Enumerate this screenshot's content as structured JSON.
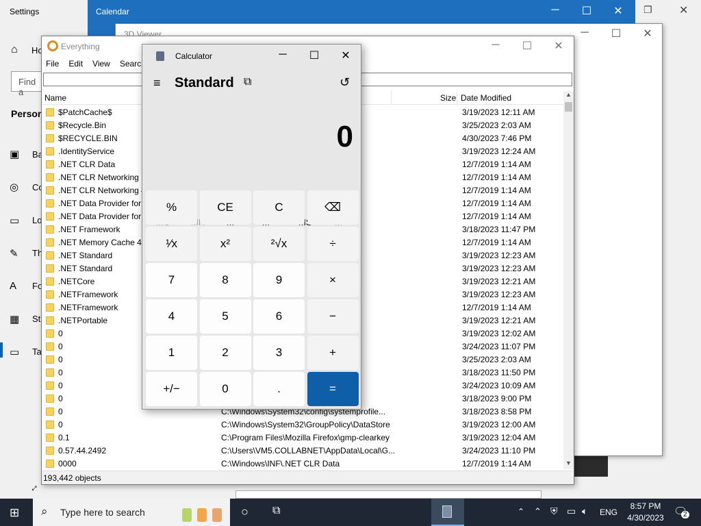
{
  "settings": {
    "title": "Settings",
    "home": "Ho",
    "find_placeholder": "Find a",
    "section": "Person",
    "items": [
      "Ba",
      "Co",
      "Lo",
      "Th",
      "Fo",
      "St",
      "Ta"
    ]
  },
  "calendar": {
    "title": "Calendar"
  },
  "viewer": {
    "title": "3D Viewer"
  },
  "everything": {
    "title": "Everything",
    "menu": [
      "File",
      "Edit",
      "View",
      "Search"
    ],
    "columns": {
      "name": "Name",
      "size": "Size",
      "date": "Date Modified"
    },
    "rows": [
      {
        "name": "$PatchCache$",
        "path": "",
        "date": "3/19/2023 12:11 AM"
      },
      {
        "name": "$Recycle.Bin",
        "path": "",
        "date": "3/25/2023 2:03 AM"
      },
      {
        "name": "$RECYCLE.BIN",
        "path": "",
        "date": "4/30/2023 7:46 PM"
      },
      {
        "name": ".IdentityService",
        "path": "",
        "date": "3/19/2023 12:24 AM"
      },
      {
        "name": ".NET CLR Data",
        "path": "",
        "date": "12/7/2019 1:14 AM"
      },
      {
        "name": ".NET CLR Networking",
        "path": "",
        "date": "12/7/2019 1:14 AM"
      },
      {
        "name": ".NET CLR Networking 4.",
        "path": "",
        "date": "12/7/2019 1:14 AM"
      },
      {
        "name": ".NET Data Provider for O",
        "path": "",
        "date": "12/7/2019 1:14 AM"
      },
      {
        "name": ".NET Data Provider for S",
        "path": "",
        "date": "12/7/2019 1:14 AM"
      },
      {
        "name": ".NET Framework",
        "path": "\\Win...",
        "date": "3/18/2023 11:47 PM"
      },
      {
        "name": ".NET Memory Cache 4.0",
        "path": "",
        "date": "12/7/2019 1:14 AM"
      },
      {
        "name": ".NET Standard",
        "path": "Studi...",
        "date": "3/19/2023 12:23 AM"
      },
      {
        "name": ".NET Standard",
        "path": "Studi...",
        "date": "3/19/2023 12:23 AM"
      },
      {
        "name": ".NETCore",
        "path": "mblies...",
        "date": "3/19/2023 12:21 AM"
      },
      {
        "name": ".NETFramework",
        "path": "mblies...",
        "date": "3/19/2023 12:23 AM"
      },
      {
        "name": ".NETFramework",
        "path": "",
        "date": "12/7/2019 1:14 AM"
      },
      {
        "name": ".NETPortable",
        "path": "mblies...",
        "date": "3/19/2023 12:21 AM"
      },
      {
        "name": "0",
        "path": "y\\Use...",
        "date": "3/19/2023 12:02 AM"
      },
      {
        "name": "0",
        "path": "y\\Use...",
        "date": "3/24/2023 11:07 PM"
      },
      {
        "name": "0",
        "path": "\\Micr...",
        "date": "3/25/2023 2:03 AM"
      },
      {
        "name": "0",
        "path": "ft\\Win...",
        "date": "3/18/2023 11:50 PM"
      },
      {
        "name": "0",
        "path": "ocal\\...",
        "date": "3/24/2023 10:09 AM"
      },
      {
        "name": "0",
        "path": "ft\\Win...",
        "date": "3/18/2023 9:00 PM"
      },
      {
        "name": "0",
        "path": "C:\\Windows\\System32\\config\\systemprofile...",
        "date": "3/18/2023 8:58 PM"
      },
      {
        "name": "0",
        "path": "C:\\Windows\\System32\\GroupPolicy\\DataStore",
        "date": "3/19/2023 12:00 AM"
      },
      {
        "name": "0.1",
        "path": "C:\\Program Files\\Mozilla Firefox\\gmp-clearkey",
        "date": "3/19/2023 12:04 AM"
      },
      {
        "name": "0.57.44.2492",
        "path": "C:\\Users\\VM5.COLLABNET\\AppData\\Local\\G...",
        "date": "3/24/2023 11:10 PM"
      },
      {
        "name": "0000",
        "path": "C:\\Windows\\INF\\.NET CLR Data",
        "date": "12/7/2019 1:14 AM"
      }
    ],
    "status": "193,442 objects"
  },
  "calculator": {
    "title": "Calculator",
    "mode": "Standard",
    "display": "0",
    "memory": [
      "MC",
      "MR",
      "M+",
      "M−",
      "MS",
      "M˅"
    ],
    "keys": [
      "%",
      "CE",
      "C",
      "⌫",
      "¹⁄x",
      "x²",
      "²√x",
      "÷",
      "7",
      "8",
      "9",
      "×",
      "4",
      "5",
      "6",
      "−",
      "1",
      "2",
      "3",
      "+",
      "+/−",
      "0",
      ".",
      "="
    ]
  },
  "taskbar": {
    "search_placeholder": "Type here to search",
    "lang": "ENG",
    "time": "8:57 PM",
    "date": "4/30/2023",
    "notif_count": "2"
  }
}
